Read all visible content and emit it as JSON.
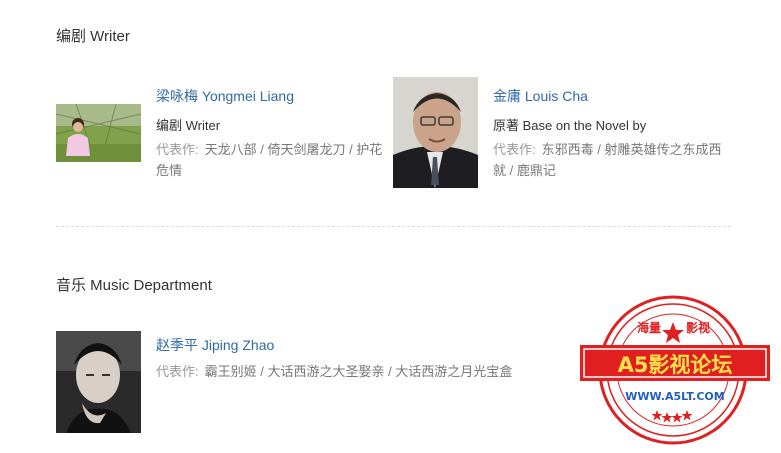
{
  "sections": {
    "writer": {
      "title": "编剧 Writer"
    },
    "music": {
      "title": "音乐 Music Department"
    }
  },
  "people": [
    {
      "name": "梁咏梅 Yongmei Liang",
      "role": "编剧 Writer",
      "works_label": "代表作:",
      "works_line1": "天龙八部 / 倚天剑屠龙刀 / 护花",
      "works_line2": "危情"
    },
    {
      "name": "金庸 Louis Cha",
      "role": "原著 Base on the Novel by",
      "works_label": "代表作:",
      "works_line1": "东邪西毒 / 射雕英雄传之东成西",
      "works_line2": "就 / 鹿鼎记"
    },
    {
      "name": "赵季平 Jiping Zhao",
      "works_label": "代表作:",
      "works_line1": "霸王别姬 / 大话西游之大圣娶亲 / 大话西游之月光宝盒"
    }
  ],
  "watermark": {
    "top_text_left": "海量",
    "top_text_right": "影视",
    "main_text": "A5影视论坛",
    "url": "WWW.A5LT.COM"
  }
}
